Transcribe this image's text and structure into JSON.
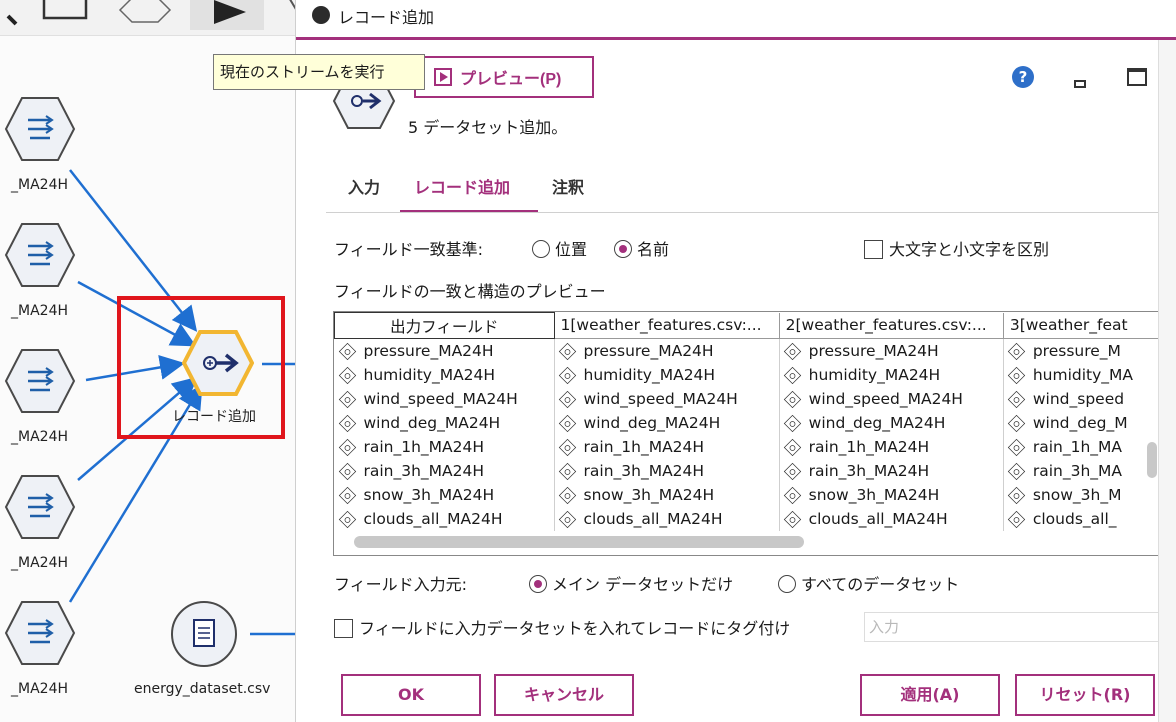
{
  "canvas": {
    "tooltip": "現在のストリームを実行",
    "nodes": [
      {
        "label": "_MA24H"
      },
      {
        "label": "_MA24H"
      },
      {
        "label": "_MA24H"
      },
      {
        "label": "_MA24H"
      },
      {
        "label": "_MA24H"
      },
      {
        "label": "レコード追加"
      },
      {
        "label": "energy_dataset.csv"
      }
    ]
  },
  "dialog": {
    "title": "レコード追加",
    "preview_button": "プレビュー(P)",
    "description": "5 データセット追加。",
    "tabs": [
      "入力",
      "レコード追加",
      "注釈"
    ],
    "active_tab": "レコード追加",
    "match_criterion": {
      "label": "フィールド一致基準:",
      "options": [
        "位置",
        "名前"
      ],
      "selected": "名前"
    },
    "case_sensitive": {
      "label": "大文字と小文字を区別",
      "checked": false
    },
    "preview_label": "フィールドの一致と構造のプレビュー",
    "table": {
      "headers": [
        "出力フィールド",
        "1[weather_features.csv:...",
        "2[weather_features.csv:...",
        "3[weather_feat"
      ],
      "rows": [
        [
          "pressure_MA24H",
          "pressure_MA24H",
          "pressure_MA24H",
          "pressure_M"
        ],
        [
          "humidity_MA24H",
          "humidity_MA24H",
          "humidity_MA24H",
          "humidity_MA"
        ],
        [
          "wind_speed_MA24H",
          "wind_speed_MA24H",
          "wind_speed_MA24H",
          "wind_speed"
        ],
        [
          "wind_deg_MA24H",
          "wind_deg_MA24H",
          "wind_deg_MA24H",
          "wind_deg_M"
        ],
        [
          "rain_1h_MA24H",
          "rain_1h_MA24H",
          "rain_1h_MA24H",
          "rain_1h_MA"
        ],
        [
          "rain_3h_MA24H",
          "rain_3h_MA24H",
          "rain_3h_MA24H",
          "rain_3h_MA"
        ],
        [
          "snow_3h_MA24H",
          "snow_3h_MA24H",
          "snow_3h_MA24H",
          "snow_3h_M"
        ],
        [
          "clouds_all_MA24H",
          "clouds_all_MA24H",
          "clouds_all_MA24H",
          "clouds_all_"
        ]
      ]
    },
    "field_source": {
      "label": "フィールド入力元:",
      "options": [
        "メイン データセットだけ",
        "すべてのデータセット"
      ],
      "selected": "メイン データセットだけ"
    },
    "tag_records": {
      "label": "フィールドに入力データセットを入れてレコードにタグ付け",
      "checked": false,
      "placeholder": "入力"
    },
    "buttons": {
      "ok": "OK",
      "cancel": "キャンセル",
      "apply": "適用(A)",
      "reset": "リセット(R)"
    },
    "colors": {
      "accent": "#a3307c",
      "highlight": "#e0151c",
      "node": "#f2b631",
      "edge": "#1f6fd1"
    }
  }
}
